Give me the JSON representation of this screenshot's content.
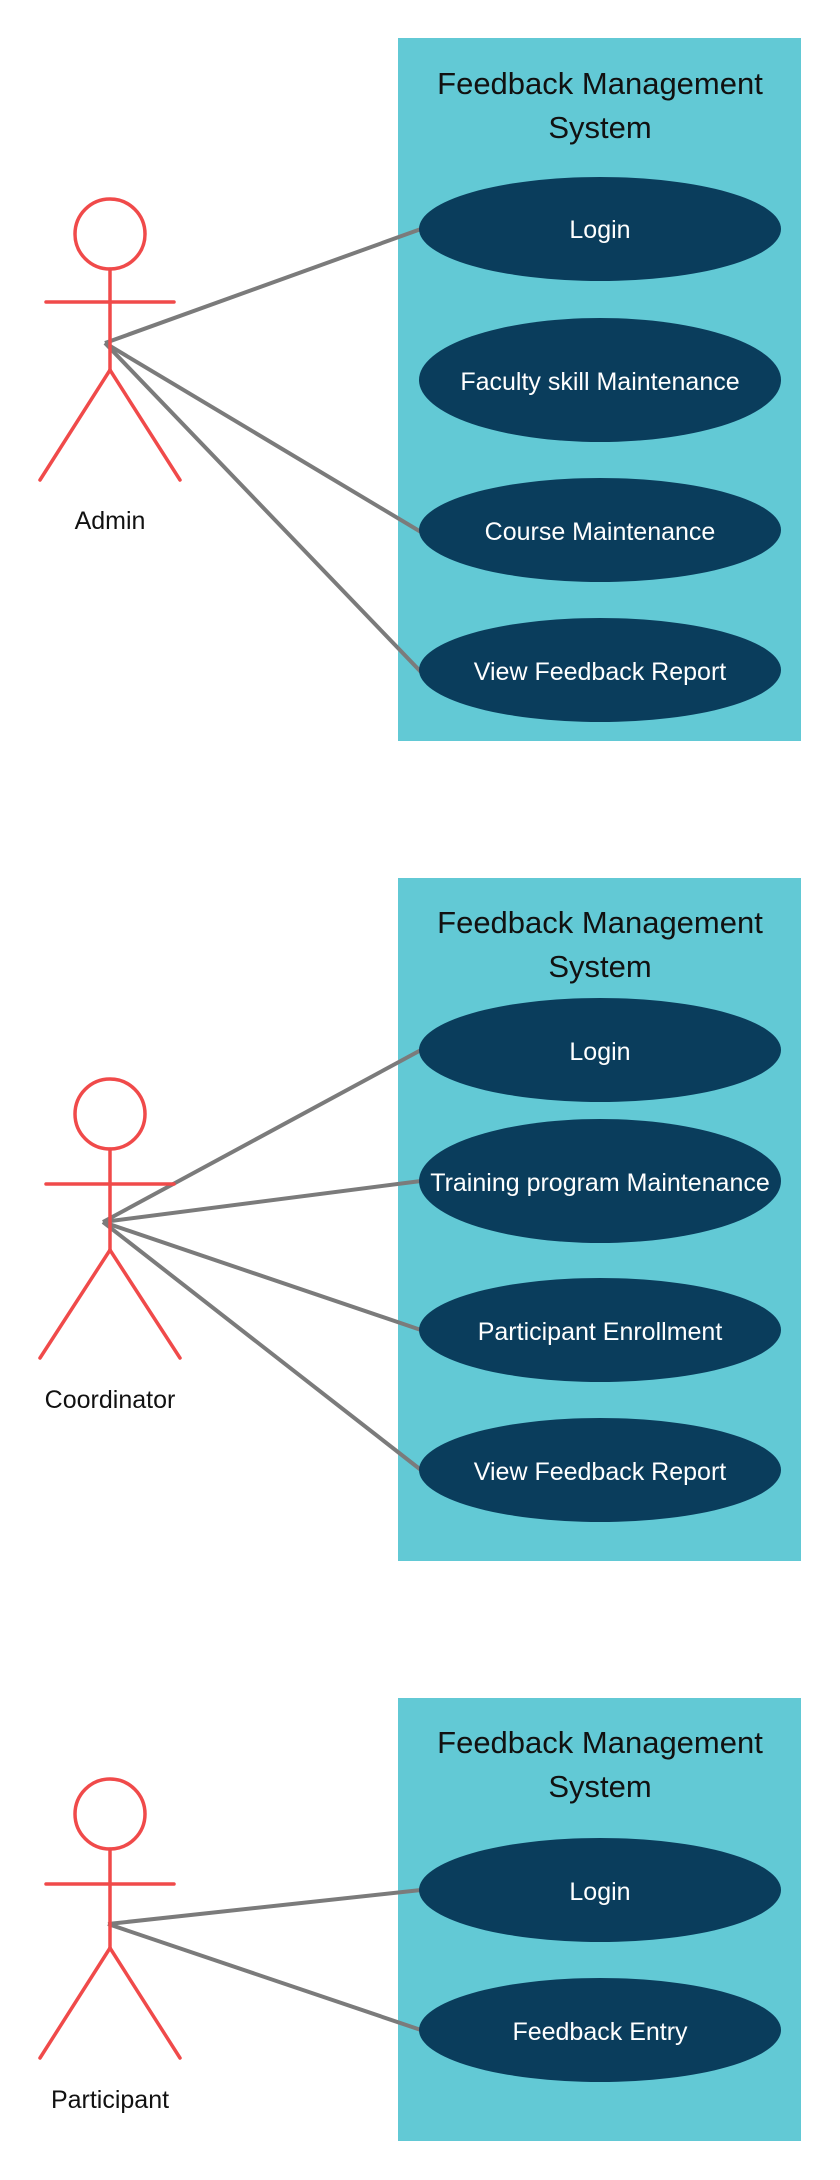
{
  "colors": {
    "system_fill": "#62C9D5",
    "usecase_fill": "#0A3D5C",
    "usecase_text": "#FFFFFF",
    "actor_stroke": "#F04A4A",
    "association_line": "#7B7B7B",
    "title_text": "#111111"
  },
  "diagrams": [
    {
      "system_title_lines": [
        "Feedback Management",
        "System"
      ],
      "actor": "Admin",
      "use_cases": [
        "Login",
        "Faculty skill Maintenance",
        "Course Maintenance",
        "View Feedback Report"
      ],
      "associations": [
        "Login",
        "Course Maintenance",
        "View Feedback Report"
      ]
    },
    {
      "system_title_lines": [
        "Feedback Management",
        "System"
      ],
      "actor": "Coordinator",
      "use_cases": [
        "Login",
        "Training program Maintenance",
        "Participant Enrollment",
        "View Feedback Report"
      ],
      "associations": [
        "Login",
        "Training program Maintenance",
        "Participant Enrollment",
        "View Feedback Report"
      ]
    },
    {
      "system_title_lines": [
        "Feedback Management",
        "System"
      ],
      "actor": "Participant",
      "use_cases": [
        "Login",
        "Feedback Entry"
      ],
      "associations": [
        "Login",
        "Feedback Entry"
      ]
    }
  ]
}
